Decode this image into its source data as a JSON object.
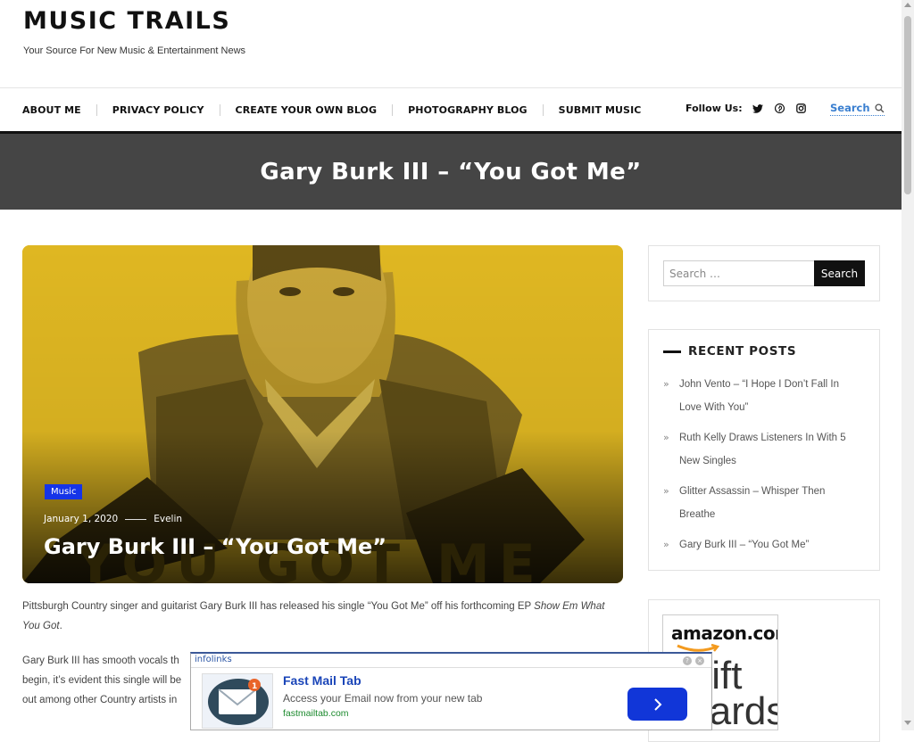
{
  "site": {
    "title": "MUSIC TRAILS",
    "tagline": "Your Source For New Music & Entertainment News"
  },
  "nav": {
    "items": [
      {
        "label": "ABOUT ME"
      },
      {
        "label": "PRIVACY POLICY"
      },
      {
        "label": "CREATE YOUR OWN BLOG"
      },
      {
        "label": "PHOTOGRAPHY BLOG"
      },
      {
        "label": "SUBMIT MUSIC"
      }
    ],
    "follow_label": "Follow Us:",
    "social_icons": [
      "twitter-icon",
      "pinterest-icon",
      "instagram-icon"
    ],
    "search_label": "Search"
  },
  "banner": {
    "title": "Gary Burk III – “You Got Me”"
  },
  "post": {
    "category": "Music",
    "date": "January 1, 2020",
    "author": "Evelin",
    "title": "Gary Burk III – “You Got Me”",
    "image_text": "YOU GOT ME",
    "para1_a": "Pittsburgh Country singer and guitarist Gary Burk III has released his single “You Got Me” off his forthcoming EP ",
    "para1_em": "Show Em What You Got",
    "para1_b": ".",
    "para2_line1": "Gary Burk III has smooth vocals th",
    "para2_line2": "begin, it’s evident this single will be",
    "para2_line3": "out among other Country artists in"
  },
  "sidebar": {
    "search_placeholder": "Search …",
    "search_button": "Search",
    "recent_title": "RECENT POSTS",
    "recent_posts": [
      {
        "l1": "John Vento – “I Hope I Don’t Fall In",
        "l2": "Love With You”"
      },
      {
        "l1": "Ruth Kelly Draws Listeners In With 5",
        "l2": "New Singles"
      },
      {
        "l1": "Glitter Assassin – Whisper Then",
        "l2": "Breathe"
      },
      {
        "l1": "Gary Burk III – “You Got Me”",
        "l2": ""
      }
    ],
    "amazon_logo": "amazon.com",
    "amazon_text": "Gift Cards"
  },
  "ad": {
    "brand": "infolinks",
    "title": "Fast Mail Tab",
    "description": "Access your Email now from your new tab",
    "url": "fastmailtab.com",
    "badge_count": "1"
  },
  "colors": {
    "accent_blue": "#1534e8",
    "banner_bg": "#454545",
    "hero_yellow": "#dfb722",
    "link_blue": "#3a7fd0"
  }
}
